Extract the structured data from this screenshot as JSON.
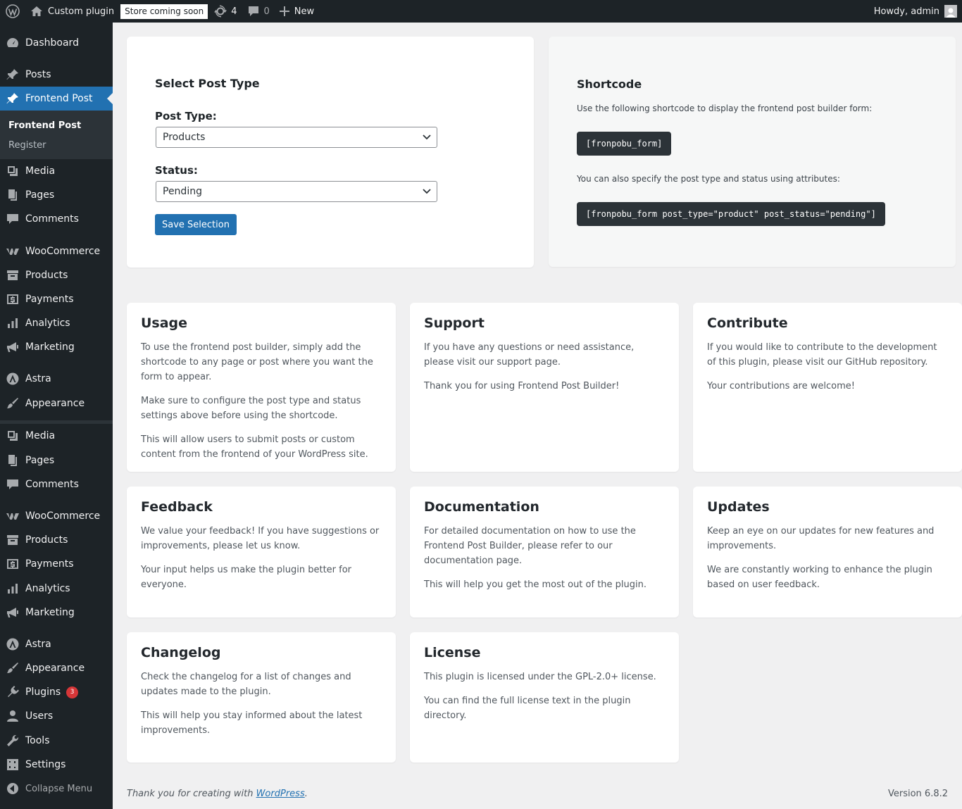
{
  "adminbar": {
    "site_name": "Custom plugin",
    "store_badge": "Store coming soon",
    "updates_count": "4",
    "comments_count": "0",
    "new_label": "New",
    "howdy": "Howdy, admin"
  },
  "sidebar": {
    "items": [
      {
        "label": "Dashboard",
        "icon": "dashboard-icon"
      },
      {
        "label": "Posts",
        "icon": "pin-icon"
      },
      {
        "label": "Frontend Post",
        "icon": "pin-icon"
      },
      {
        "label": "Media",
        "icon": "media-icon"
      },
      {
        "label": "Pages",
        "icon": "pages-icon"
      },
      {
        "label": "Comments",
        "icon": "comment-icon"
      },
      {
        "label": "WooCommerce",
        "icon": "woo-icon"
      },
      {
        "label": "Products",
        "icon": "archive-icon"
      },
      {
        "label": "Payments",
        "icon": "dollar-icon"
      },
      {
        "label": "Analytics",
        "icon": "bar-chart-icon"
      },
      {
        "label": "Marketing",
        "icon": "megaphone-icon"
      },
      {
        "label": "Astra",
        "icon": "astra-icon"
      },
      {
        "label": "Appearance",
        "icon": "brush-icon"
      },
      {
        "label": "Media",
        "icon": "media-icon"
      },
      {
        "label": "Pages",
        "icon": "pages-icon"
      },
      {
        "label": "Comments",
        "icon": "comment-icon"
      },
      {
        "label": "WooCommerce",
        "icon": "woo-icon"
      },
      {
        "label": "Products",
        "icon": "archive-icon"
      },
      {
        "label": "Payments",
        "icon": "dollar-icon"
      },
      {
        "label": "Analytics",
        "icon": "bar-chart-icon"
      },
      {
        "label": "Marketing",
        "icon": "megaphone-icon"
      },
      {
        "label": "Astra",
        "icon": "astra-icon"
      },
      {
        "label": "Appearance",
        "icon": "brush-icon"
      },
      {
        "label": "Plugins",
        "icon": "plugin-icon",
        "badge": "3"
      },
      {
        "label": "Users",
        "icon": "user-icon"
      },
      {
        "label": "Tools",
        "icon": "wrench-icon"
      },
      {
        "label": "Settings",
        "icon": "settings-icon"
      }
    ],
    "submenu": [
      "Frontend Post",
      "Register"
    ],
    "collapse": "Collapse Menu"
  },
  "select_card": {
    "title": "Select Post Type",
    "post_type_label": "Post Type:",
    "post_type_value": "Products",
    "status_label": "Status:",
    "status_value": "Pending",
    "save_button": "Save Selection"
  },
  "shortcode_card": {
    "title": "Shortcode",
    "intro": "Use the following shortcode to display the frontend post builder form:",
    "code1": "[fronpobu_form]",
    "attr_text": "You can also specify the post type and status using attributes:",
    "code2": "[fronpobu_form post_type=\"product\" post_status=\"pending\"]"
  },
  "info_cards": [
    {
      "title": "Usage",
      "paragraphs": [
        "To use the frontend post builder, simply add the shortcode to any page or post where you want the form to appear.",
        "Make sure to configure the post type and status settings above before using the shortcode.",
        "This will allow users to submit posts or custom content from the frontend of your WordPress site."
      ]
    },
    {
      "title": "Support",
      "paragraphs": [
        "If you have any questions or need assistance, please visit our support page.",
        "Thank you for using Frontend Post Builder!"
      ]
    },
    {
      "title": "Contribute",
      "paragraphs": [
        "If you would like to contribute to the development of this plugin, please visit our GitHub repository.",
        "Your contributions are welcome!"
      ]
    },
    {
      "title": "Feedback",
      "paragraphs": [
        "We value your feedback! If you have suggestions or improvements, please let us know.",
        "Your input helps us make the plugin better for everyone."
      ]
    },
    {
      "title": "Documentation",
      "paragraphs": [
        "For detailed documentation on how to use the Frontend Post Builder, please refer to our documentation page.",
        "This will help you get the most out of the plugin."
      ]
    },
    {
      "title": "Updates",
      "paragraphs": [
        "Keep an eye on our updates for new features and improvements.",
        "We are constantly working to enhance the plugin based on user feedback."
      ]
    },
    {
      "title": "Changelog",
      "paragraphs": [
        "Check the changelog for a list of changes and updates made to the plugin.",
        "This will help you stay informed about the latest improvements."
      ]
    },
    {
      "title": "License",
      "paragraphs": [
        "This plugin is licensed under the GPL-2.0+ license.",
        "You can find the full license text in the plugin directory."
      ]
    }
  ],
  "footer": {
    "thanks_prefix": "Thank you for creating with ",
    "thanks_link": "WordPress",
    "thanks_suffix": ".",
    "version": "Version 6.8.2"
  },
  "colors": {
    "accent": "#2271b1",
    "sidebar": "#1d2327",
    "badge": "#d63638"
  }
}
